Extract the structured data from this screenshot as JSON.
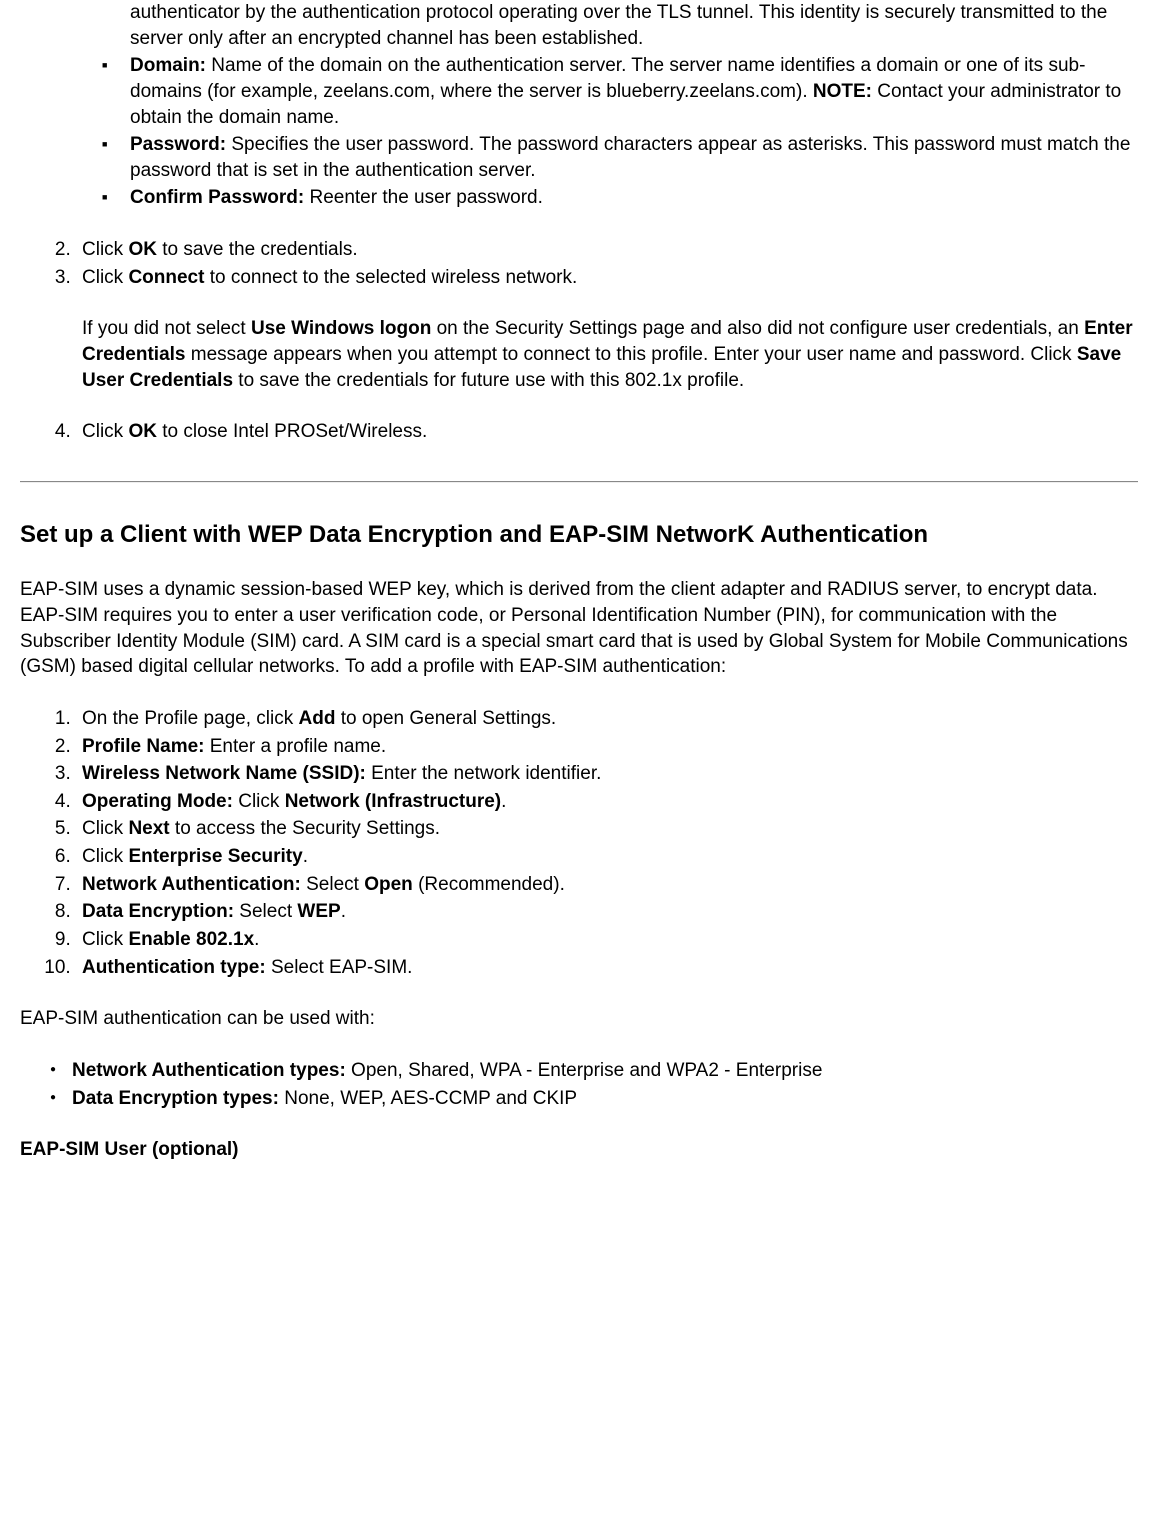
{
  "top_fragment": "authenticator by the authentication protocol operating over the TLS tunnel. This identity is securely transmitted to the server only after an encrypted channel has been established.",
  "sub_bullets": [
    {
      "label": "Domain:",
      "text": " Name of the domain on the authentication server. The server name identifies a domain or one of its sub-domains (for example, zeelans.com, where the server is blueberry.zeelans.com). ",
      "note_label": "NOTE:",
      "note_text": " Contact your administrator to obtain the domain name."
    },
    {
      "label": "Password:",
      "text": " Specifies the user password. The password characters appear as asterisks. This password must match the password that is set in the authentication server."
    },
    {
      "label": "Confirm Password:",
      "text": " Reenter the user password."
    }
  ],
  "steps": {
    "s2_pre": "Click ",
    "s2_b": "OK",
    "s2_post": " to save the credentials.",
    "s3_pre": "Click ",
    "s3_b": "Connect",
    "s3_post": " to connect to the selected wireless network.",
    "s3_para_1a": "If you did not select ",
    "s3_para_1b": "Use Windows logon",
    "s3_para_1c": " on the Security Settings page and also did not configure user credentials, an ",
    "s3_para_1d": "Enter Credentials",
    "s3_para_1e": " message appears when you attempt to connect to this profile. Enter your user name and password. Click ",
    "s3_para_1f": "Save User Credentials",
    "s3_para_1g": " to save the credentials for future use with this 802.1x profile.",
    "s4_pre": "Click ",
    "s4_b": "OK",
    "s4_post": " to close Intel PROSet/Wireless."
  },
  "section_heading": "Set up a Client with WEP Data Encryption and EAP-SIM NetworK Authentication",
  "section_intro": "EAP-SIM uses a dynamic session-based WEP key, which is derived from the client adapter and RADIUS server, to encrypt data. EAP-SIM requires you to enter a user verification code, or Personal Identification Number (PIN), for communication with the Subscriber Identity Module (SIM) card. A SIM card is a special smart card that is used by Global System for Mobile Communications (GSM) based digital cellular networks. To add a profile with EAP-SIM authentication:",
  "steps2": {
    "s1_a": "On the Profile page, click ",
    "s1_b": "Add",
    "s1_c": " to open General Settings.",
    "s2_a": "Profile Name:",
    "s2_b": " Enter a profile name.",
    "s3_a": "Wireless Network Name (SSID):",
    "s3_b": " Enter the network identifier.",
    "s4_a": "Operating Mode:",
    "s4_b": " Click ",
    "s4_c": "Network (Infrastructure)",
    "s4_d": ".",
    "s5_a": "Click ",
    "s5_b": "Next",
    "s5_c": " to access the Security Settings.",
    "s6_a": "Click ",
    "s6_b": "Enterprise Security",
    "s6_c": ".",
    "s7_a": "Network Authentication:",
    "s7_b": " Select ",
    "s7_c": "Open",
    "s7_d": " (Recommended).",
    "s8_a": "Data Encryption:",
    "s8_b": " Select ",
    "s8_c": "WEP",
    "s8_d": ".",
    "s9_a": "Click ",
    "s9_b": "Enable 802.1x",
    "s9_c": ".",
    "s10_a": "Authentication type:",
    "s10_b": " Select EAP-SIM."
  },
  "lead_in": "EAP-SIM authentication can be used with:",
  "auth_bullets": [
    {
      "label": "Network Authentication types:",
      "text": " Open, Shared, WPA - Enterprise and WPA2 - Enterprise"
    },
    {
      "label": "Data Encryption types:",
      "text": " None, WEP, AES-CCMP and CKIP"
    }
  ],
  "sub_heading": "EAP-SIM User (optional)"
}
